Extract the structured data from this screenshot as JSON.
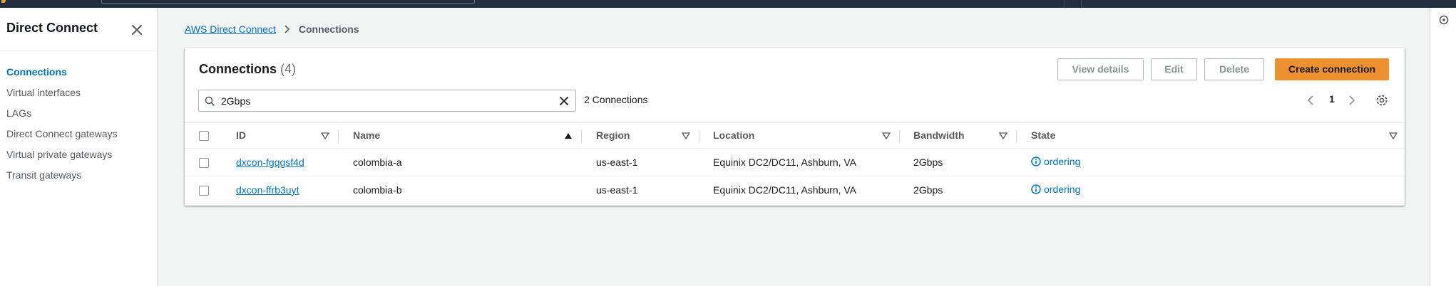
{
  "sidebar": {
    "title": "Direct Connect",
    "items": [
      {
        "label": "Connections",
        "active": true
      },
      {
        "label": "Virtual interfaces"
      },
      {
        "label": "LAGs"
      },
      {
        "label": "Direct Connect gateways"
      },
      {
        "label": "Virtual private gateways"
      },
      {
        "label": "Transit gateways"
      }
    ]
  },
  "breadcrumb": {
    "root": "AWS Direct Connect",
    "current": "Connections"
  },
  "panel": {
    "title": "Connections",
    "count": "(4)",
    "buttons": {
      "view_details": "View details",
      "edit": "Edit",
      "delete": "Delete",
      "create": "Create connection"
    },
    "search": {
      "value": "2Gbps",
      "match_count": "2 Connections"
    },
    "pagination": {
      "page": "1"
    }
  },
  "table": {
    "columns": [
      "ID",
      "Name",
      "Region",
      "Location",
      "Bandwidth",
      "State"
    ],
    "sorted_column": "Name",
    "sort_direction": "ascending",
    "rows": [
      {
        "id": "dxcon-fgqgsf4d",
        "name": "colombia-a",
        "region": "us-east-1",
        "location": "Equinix DC2/DC11, Ashburn, VA",
        "bandwidth": "2Gbps",
        "state": "ordering"
      },
      {
        "id": "dxcon-ffrb3uyt",
        "name": "colombia-b",
        "region": "us-east-1",
        "location": "Equinix DC2/DC11, Ashburn, VA",
        "bandwidth": "2Gbps",
        "state": "ordering"
      }
    ]
  },
  "colors": {
    "link": "#0073bb",
    "primary_button": "#ec912f",
    "topbar": "#232f3e"
  },
  "icons": [
    "close-icon",
    "chevron-right-icon",
    "search-icon",
    "clear-icon",
    "chevron-left-icon",
    "settings-gear-icon",
    "sort-down-icon",
    "sort-up-icon",
    "info-icon",
    "notifications-icon"
  ]
}
